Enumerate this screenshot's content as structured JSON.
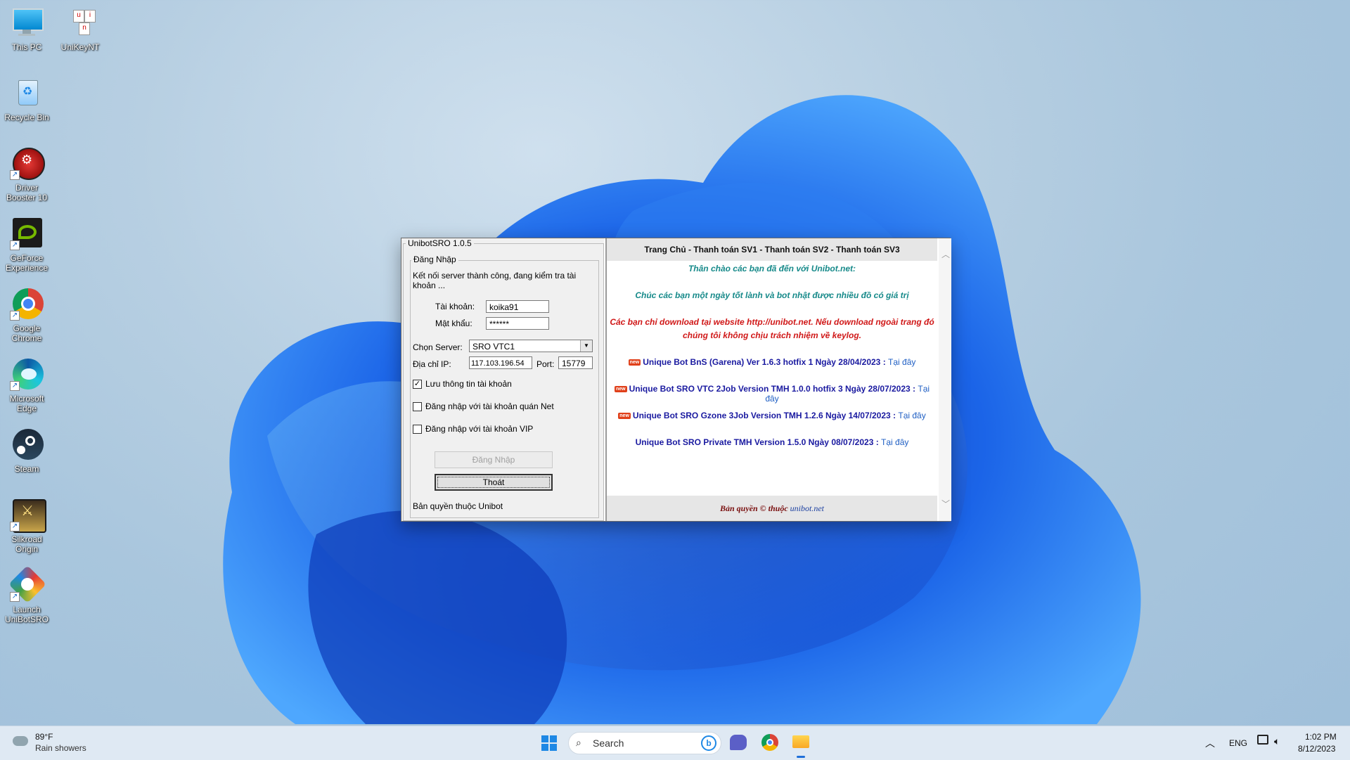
{
  "desktop": {
    "icons": [
      {
        "label": "This PC"
      },
      {
        "label": "UniKeyNT"
      },
      {
        "label": "Recycle Bin"
      },
      {
        "label": "Driver Booster 10"
      },
      {
        "label": "GeForce Experience"
      },
      {
        "label": "Google Chrome"
      },
      {
        "label": "Microsoft Edge"
      },
      {
        "label": "Steam"
      },
      {
        "label": "Silkroad Origin"
      },
      {
        "label": "Launch UniBotSRO"
      }
    ]
  },
  "window": {
    "title": "UnibotSRO 1.0.5",
    "login_group_title": "Đăng Nhập",
    "status_text": "Kết nối server thành công, đang kiểm tra tài khoản ...",
    "account_label": "Tài khoản:",
    "account_value": "koika91",
    "password_label": "Mật khẩu:",
    "password_value": "******",
    "server_label": "Chọn Server:",
    "server_value": "SRO VTC1",
    "ip_label": "Địa chỉ IP:",
    "ip_value": "117.103.196.54",
    "port_label": "Port:",
    "port_value": "15779",
    "remember_label": "Lưu thông tin tài khoản",
    "remember_checked": true,
    "netcafe_label": "Đăng nhập với tài khoản quán Net",
    "netcafe_checked": false,
    "vip_label": "Đăng nhập với tài khoản VIP",
    "vip_checked": false,
    "login_button": "Đăng Nhập",
    "exit_button": "Thoát",
    "copyright": "Bản quyền thuộc Unibot"
  },
  "news_panel": {
    "header": "Trang Chủ - Thanh toán SV1 - Thanh toán SV2 - Thanh toán SV3",
    "welcome": "Thân chào các bạn đã đến với Unibot.net:",
    "wish": "Chúc các bạn một ngày tốt lành và bot nhật được nhiều đồ có giá trị",
    "warning_line1": "Các bạn chỉ download tại website http://unibot.net. Nếu download ngoài trang đó",
    "warning_line2": "chúng tôi không chịu trách nhiệm về keylog.",
    "new_badge": "new",
    "items": [
      {
        "text": "Unique Bot BnS (Garena) Ver 1.6.3 hotfix 1 Ngày 28/04/2023 :",
        "link": "Tại đây",
        "is_new": true
      },
      {
        "text": "Unique Bot SRO VTC 2Job Version TMH 1.0.0 hotfix 3 Ngày 28/07/2023 :",
        "link": "Tại đây",
        "is_new": true
      },
      {
        "text": "Unique Bot SRO Gzone 3Job Version TMH 1.2.6 Ngày 14/07/2023 :",
        "link": "Tại đây",
        "is_new": true
      },
      {
        "text": "Unique Bot SRO Private TMH Version 1.5.0 Ngày 08/07/2023 :",
        "link": "Tại đây",
        "is_new": false
      }
    ],
    "footer_prefix": "Bản quyền © thuộc",
    "footer_site": "unibot.net"
  },
  "taskbar": {
    "weather_temp": "89°F",
    "weather_desc": "Rain showers",
    "search_placeholder": "Search",
    "language": "ENG",
    "time": "1:02 PM",
    "date": "8/12/2023"
  }
}
